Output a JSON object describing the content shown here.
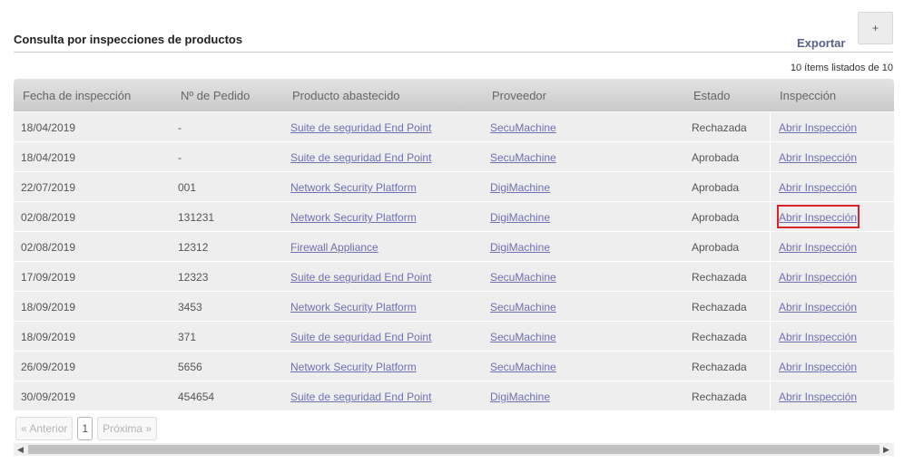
{
  "header": {
    "title": "Consulta por inspecciones de productos",
    "add_label": "+",
    "export_label": "Exportar",
    "count_text": "10 ítems listados de 10"
  },
  "table": {
    "columns": [
      "Fecha de inspección",
      "Nº de Pedido",
      "Producto abastecido",
      "Proveedor",
      "Estado",
      "Inspección"
    ],
    "rows": [
      {
        "fecha": "18/04/2019",
        "pedido": "-",
        "producto": "Suite de seguridad End Point",
        "proveedor": "SecuMachine",
        "estado": "Rechazada",
        "inspeccion": "Abrir Inspección"
      },
      {
        "fecha": "18/04/2019",
        "pedido": "-",
        "producto": "Suite de seguridad End Point",
        "proveedor": "SecuMachine",
        "estado": "Aprobada",
        "inspeccion": "Abrir Inspección"
      },
      {
        "fecha": "22/07/2019",
        "pedido": "001",
        "producto": "Network Security Platform",
        "proveedor": "DigiMachine",
        "estado": "Aprobada",
        "inspeccion": "Abrir Inspección"
      },
      {
        "fecha": "02/08/2019",
        "pedido": "131231",
        "producto": "Network Security Platform",
        "proveedor": "DigiMachine",
        "estado": "Aprobada",
        "inspeccion": "Abrir Inspección"
      },
      {
        "fecha": "02/08/2019",
        "pedido": "12312",
        "producto": "Firewall Appliance",
        "proveedor": "DigiMachine",
        "estado": "Aprobada",
        "inspeccion": "Abrir Inspección"
      },
      {
        "fecha": "17/09/2019",
        "pedido": "12323",
        "producto": "Suite de seguridad End Point",
        "proveedor": "SecuMachine",
        "estado": "Rechazada",
        "inspeccion": "Abrir Inspección"
      },
      {
        "fecha": "18/09/2019",
        "pedido": "3453",
        "producto": "Network Security Platform",
        "proveedor": "SecuMachine",
        "estado": "Rechazada",
        "inspeccion": "Abrir Inspección"
      },
      {
        "fecha": "18/09/2019",
        "pedido": "371",
        "producto": "Suite de seguridad End Point",
        "proveedor": "SecuMachine",
        "estado": "Rechazada",
        "inspeccion": "Abrir Inspección"
      },
      {
        "fecha": "26/09/2019",
        "pedido": "5656",
        "producto": "Network Security Platform",
        "proveedor": "SecuMachine",
        "estado": "Rechazada",
        "inspeccion": "Abrir Inspección"
      },
      {
        "fecha": "30/09/2019",
        "pedido": "454654",
        "producto": "Suite de seguridad End Point",
        "proveedor": "DigiMachine",
        "estado": "Rechazada",
        "inspeccion": "Abrir Inspección"
      }
    ]
  },
  "pagination": {
    "prev_label": "« Anterior",
    "current_page": "1",
    "next_label": "Próxima »"
  },
  "scrollbar": {
    "left_arrow": "◀",
    "right_arrow": "▶"
  },
  "colors": {
    "link": "#6f6fb5",
    "row_bg": "#eeeeee",
    "highlight": "#d8232a"
  }
}
